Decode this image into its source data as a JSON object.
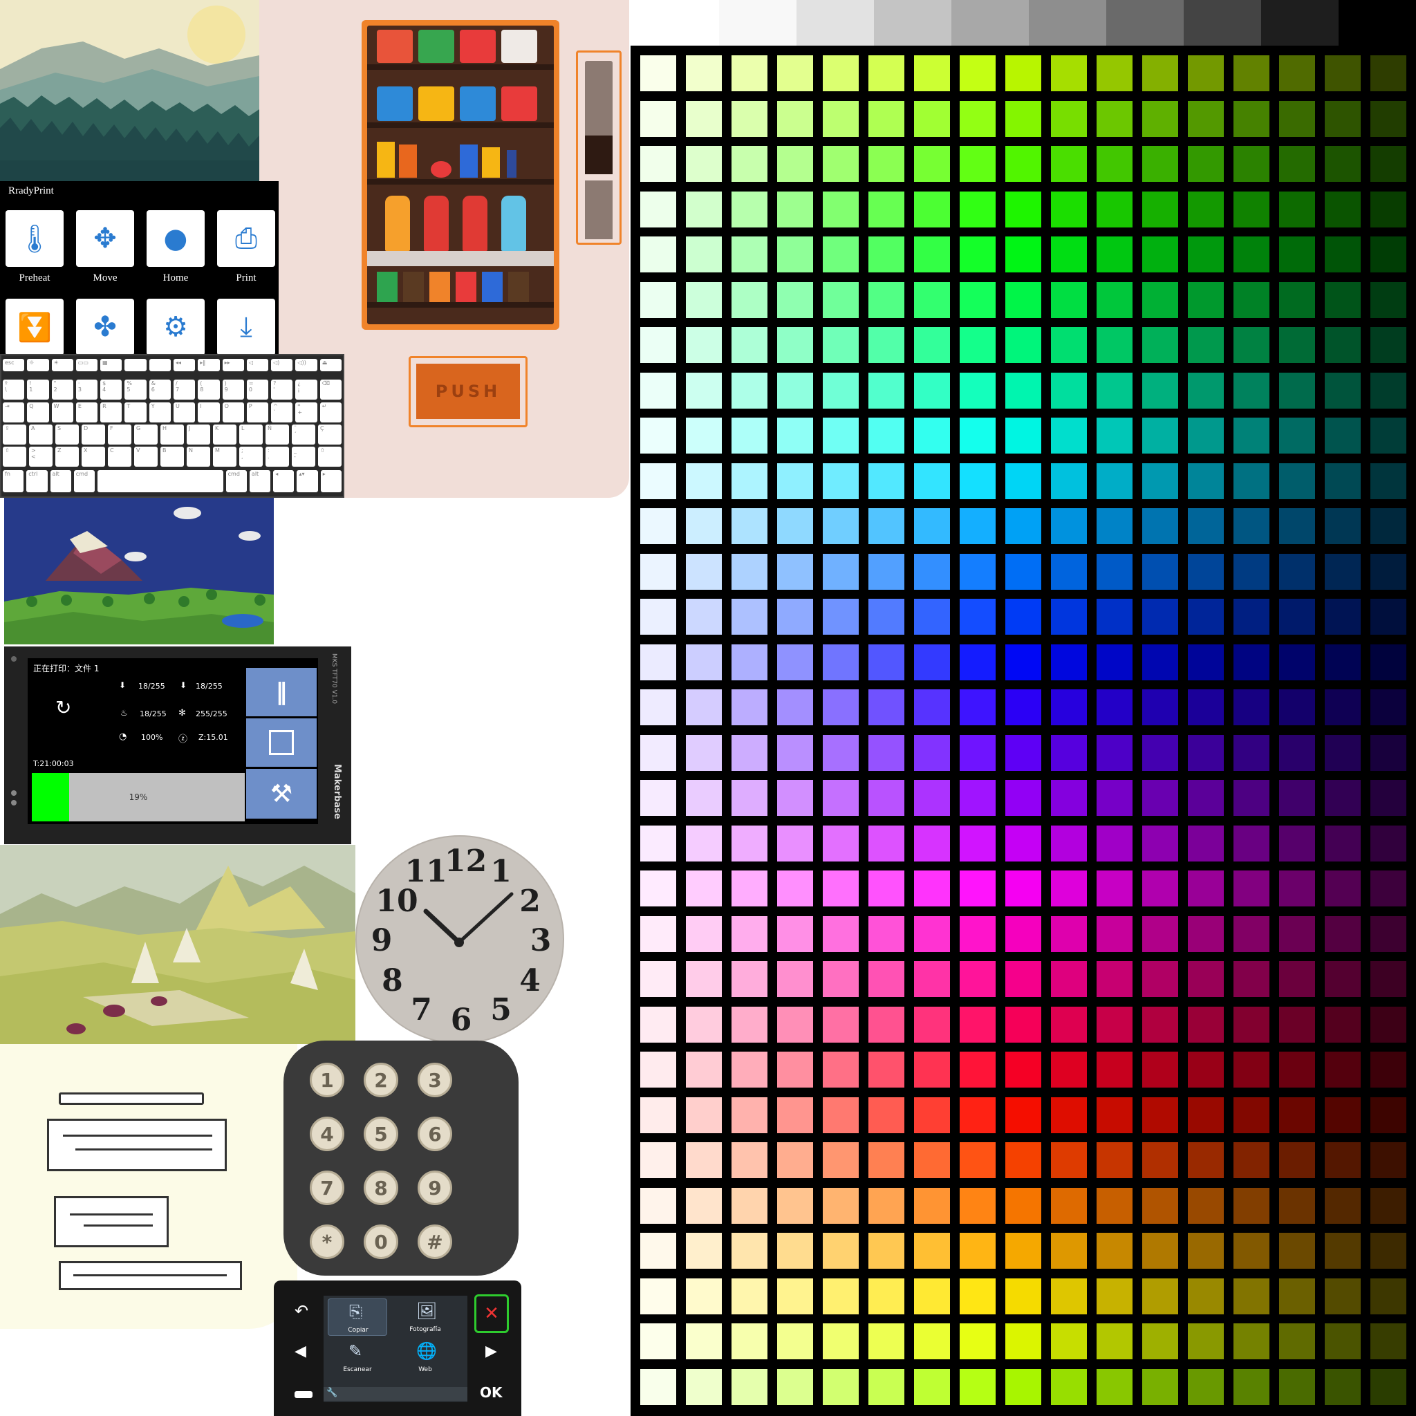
{
  "vending": {
    "push_label": "PUSH",
    "colors": {
      "background": "#f1ded8",
      "cabinet": "#f0832a",
      "shelf_wall": "#4a2a1c",
      "push": "#d9651e"
    }
  },
  "printer_menu": {
    "title": "RradyPrint",
    "buttons": [
      {
        "label": "Preheat",
        "icon": "thermometer-icon"
      },
      {
        "label": "Move",
        "icon": "move-arrows-icon"
      },
      {
        "label": "Home",
        "icon": "home-ball-icon"
      },
      {
        "label": "Print",
        "icon": "printer-icon"
      },
      {
        "label": "",
        "icon": "extruder-icon"
      },
      {
        "label": "",
        "icon": "fan-icon"
      },
      {
        "label": "",
        "icon": "settings-gear-icon"
      },
      {
        "label": "",
        "icon": "level-nozzle-icon"
      }
    ]
  },
  "keyboard": {
    "fn_row": [
      "esc",
      "☼",
      "☀",
      "▭▭",
      "▦",
      "",
      "",
      "◂◂",
      "▸‖",
      "▸▸",
      "◁",
      "◁)",
      "◁))",
      "⏏"
    ],
    "row1": [
      "º\n\\",
      "!\n1",
      "\"\n2",
      "·\n3",
      "$\n4",
      "%\n5",
      "&\n6",
      "/\n7",
      "(\n8",
      ")\n9",
      "=\n0",
      "?\n'",
      "¿\n¡",
      "⌫"
    ],
    "row2": [
      "⇥",
      "Q",
      "W",
      "E",
      "R",
      "T",
      "Y",
      "U",
      "I",
      "O",
      "P",
      "^\n`",
      "*\n+",
      "↵"
    ],
    "row3": [
      "⇪",
      "A",
      "S",
      "D",
      "F",
      "G",
      "H",
      "J",
      "K",
      "L",
      "Ñ",
      "¨\n´",
      "Ç"
    ],
    "row4": [
      "⇧",
      ">\n<",
      "Z",
      "X",
      "C",
      "V",
      "B",
      "N",
      "M",
      ";\n,",
      ":\n.",
      "_\n-",
      "⇧"
    ],
    "row5": [
      "fn",
      "ctrl",
      "alt",
      "cmd",
      "",
      "cmd",
      "alt",
      "◂",
      "▴▾",
      "▸"
    ]
  },
  "mks_printer": {
    "status": "正在打印：文件 1",
    "nozzle1": "18/255",
    "nozzle2": "18/255",
    "bed": "18/255",
    "fan": "255/255",
    "speed": "100%",
    "z": "Z:15.01",
    "time": "T:21:00:03",
    "progress_text": "19%",
    "progress": 0.19,
    "board_label": "MKS TFT70 V1.0",
    "brand": "Makerbase",
    "accent": "#6e8fc9"
  },
  "clock": {
    "numbers": [
      "12",
      "1",
      "2",
      "3",
      "4",
      "5",
      "6",
      "7",
      "8",
      "9",
      "10",
      "11"
    ]
  },
  "keypad": {
    "keys": [
      "1",
      "2",
      "3",
      "4",
      "5",
      "6",
      "7",
      "8",
      "9",
      "*",
      "0",
      "#"
    ]
  },
  "copier": {
    "items": [
      {
        "label": "Copiar",
        "icon": "copy-icon"
      },
      {
        "label": "Fotografía",
        "icon": "photo-icon"
      },
      {
        "label": "Escanear",
        "icon": "scan-icon"
      },
      {
        "label": "Web",
        "icon": "web-globe-icon"
      }
    ],
    "ok_label": "OK",
    "cancel_color": "#2ecc2e"
  },
  "palette": {
    "grayscale": [
      "#f8f8f8",
      "#e2e2e2",
      "#c4c4c4",
      "#a8a8a8",
      "#8e8e8e",
      "#6a6a6a",
      "#444444",
      "#1e1e1e",
      "#000000"
    ],
    "columns": 17,
    "rows": 30
  }
}
